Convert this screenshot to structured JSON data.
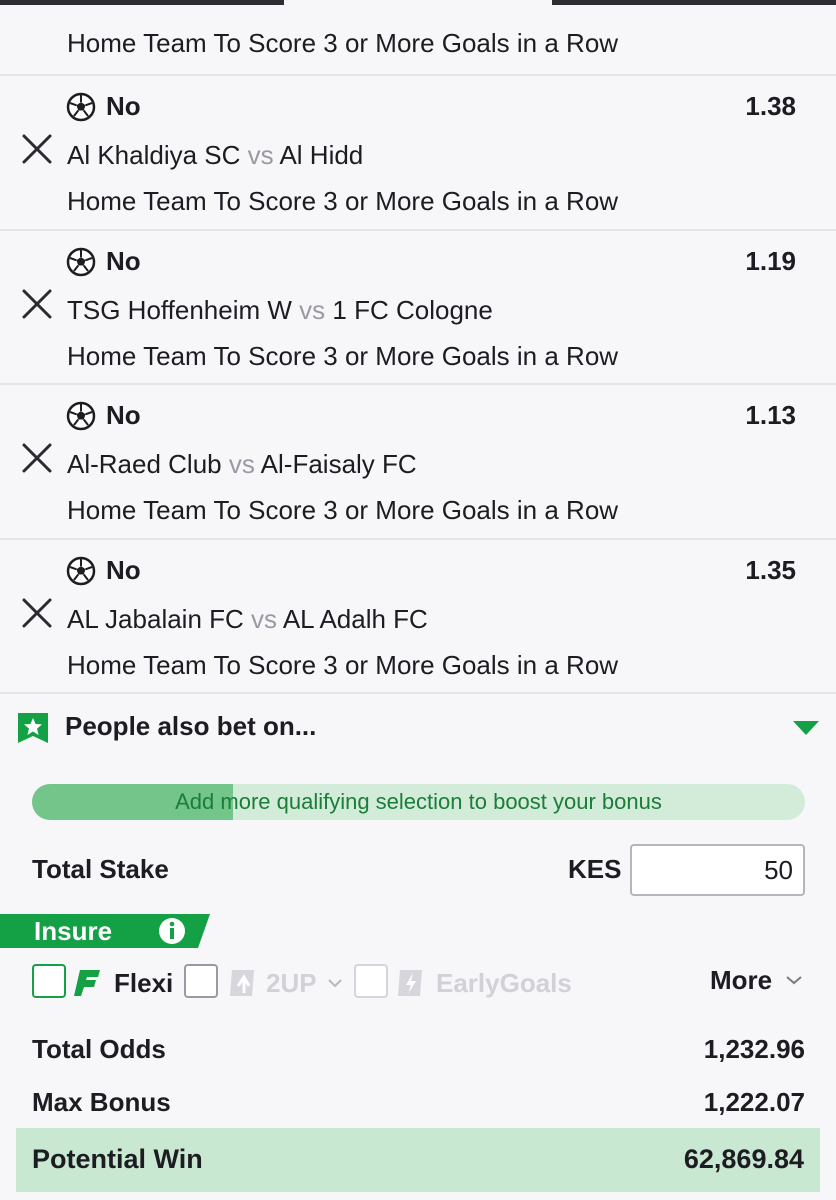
{
  "first_selection": {
    "market": "Home Team To Score 3 or More Goals in a Row"
  },
  "selections": [
    {
      "pick": "No",
      "odds": "1.38",
      "home": "Al Khaldiya SC",
      "vs": "vs",
      "away": "Al Hidd",
      "market": "Home Team To Score 3 or More Goals in a Row"
    },
    {
      "pick": "No",
      "odds": "1.19",
      "home": "TSG Hoffenheim W",
      "vs": "vs",
      "away": "1 FC Cologne",
      "market": "Home Team To Score 3 or More Goals in a Row"
    },
    {
      "pick": "No",
      "odds": "1.13",
      "home": "Al-Raed Club",
      "vs": "vs",
      "away": "Al-Faisaly FC",
      "market": "Home Team To Score 3 or More Goals in a Row"
    },
    {
      "pick": "No",
      "odds": "1.35",
      "home": "AL Jabalain FC",
      "vs": "vs",
      "away": "AL Adalh FC",
      "market": "Home Team To Score 3 or More Goals in a Row"
    }
  ],
  "people_also_bet": {
    "label": "People also bet on..."
  },
  "bonus_progress": {
    "text": "Add more qualifying selection to boost your bonus",
    "fraction": 0.26
  },
  "stake": {
    "label": "Total Stake",
    "currency": "KES",
    "value": "50"
  },
  "insure": {
    "label": "Insure"
  },
  "options": {
    "flexi": "Flexi",
    "two_up": "2UP",
    "early_goals": "EarlyGoals",
    "more": "More"
  },
  "totals": {
    "total_odds_label": "Total Odds",
    "total_odds_value": "1,232.96",
    "max_bonus_label": "Max Bonus",
    "max_bonus_value": "1,222.07",
    "potential_win_label": "Potential Win",
    "potential_win_value": "62,869.84"
  },
  "colors": {
    "brand_green": "#14a045",
    "progress_fill": "#73c58a",
    "progress_track": "#d3ecd9",
    "potential_bg": "#c9e8d1"
  },
  "icons": [
    "close-icon",
    "soccer-ball-icon",
    "star-badge-icon",
    "caret-down-icon",
    "info-icon",
    "flexi-icon",
    "two-up-icon",
    "early-goals-icon",
    "chevron-down-icon"
  ]
}
